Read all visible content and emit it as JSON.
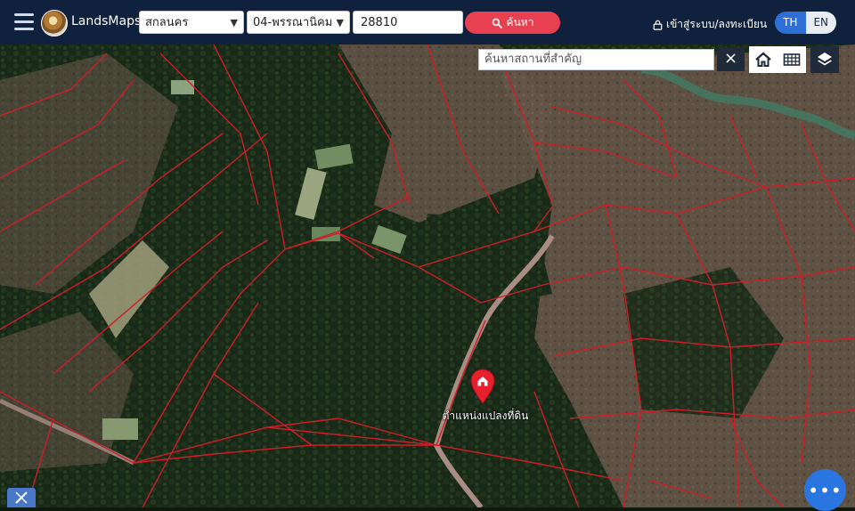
{
  "app": {
    "brand": "LandsMaps"
  },
  "topbar": {
    "province_select": "สกลนคร",
    "district_select": "04-พรรณานิคม",
    "parcel_number": "28810",
    "search_label": "ค้นหา",
    "login_label": "เข้าสู่ระบบ/ลงทะเบียน",
    "lang_th": "TH",
    "lang_en": "EN",
    "active_lang": "TH"
  },
  "map_tools": {
    "place_search_placeholder": "ค้นหาสถานที่สำคัญ",
    "close_symbol": "×",
    "home_icon": "home-icon",
    "grid_icon": "grid-icon",
    "layers_icon": "layers-icon"
  },
  "marker": {
    "label": "ตำแหน่งแปลงที่ดิน"
  },
  "fab": {
    "symbol": "•••"
  },
  "colors": {
    "topbar_bg": "#10213d",
    "search_button": "#e84050",
    "lang_active": "#2d6fd6",
    "parcel_lines": "#e0202c",
    "marker": "#e8202e",
    "fab": "#2a76e0"
  }
}
